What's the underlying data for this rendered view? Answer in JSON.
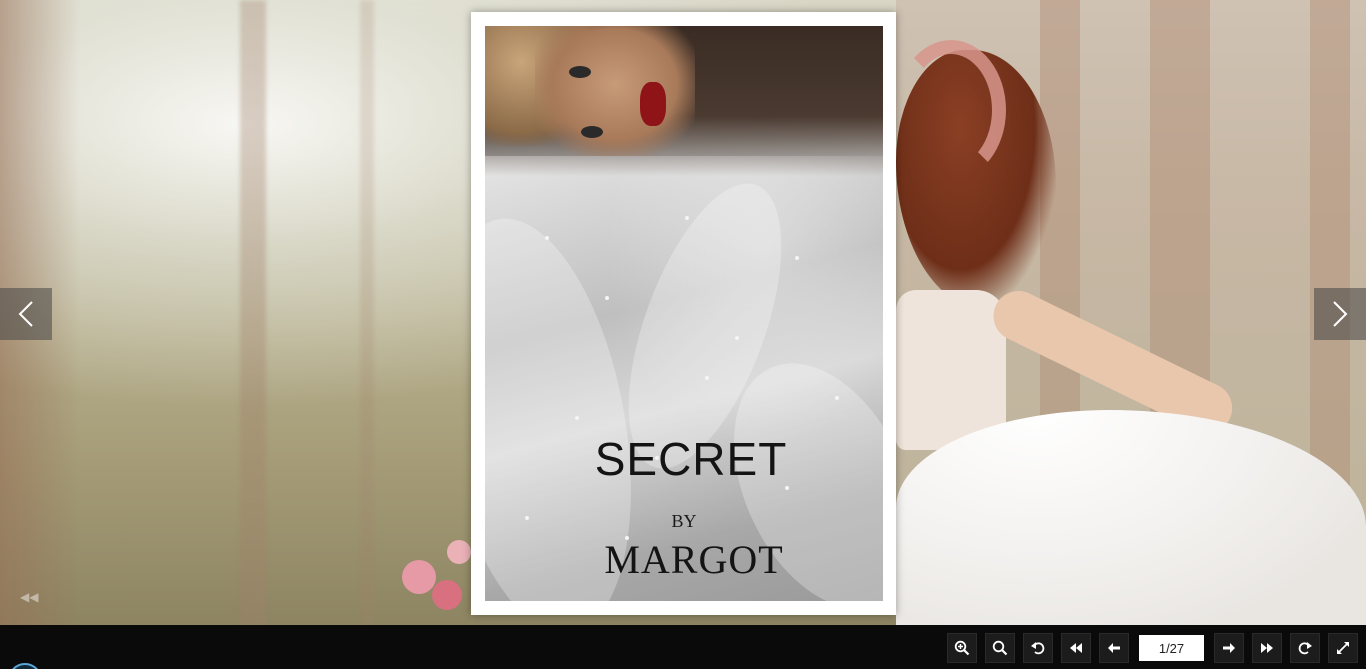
{
  "book": {
    "cover_title": "SECRET",
    "cover_by": "BY",
    "cover_author": "MARGOT"
  },
  "navigation": {
    "prev_icon": "chevron-left-icon",
    "next_icon": "chevron-right-icon"
  },
  "toolbar": {
    "buttons": [
      {
        "name": "zoom-in-button",
        "icon": "zoom-in-icon"
      },
      {
        "name": "zoom-out-button",
        "icon": "zoom-out-icon"
      },
      {
        "name": "rotate-left-button",
        "icon": "undo-icon"
      },
      {
        "name": "first-page-button",
        "icon": "double-left-arrow-icon"
      },
      {
        "name": "previous-page-button",
        "icon": "arrow-left-icon"
      },
      {
        "name": "next-page-button",
        "icon": "arrow-right-icon"
      },
      {
        "name": "last-page-button",
        "icon": "double-right-arrow-icon"
      },
      {
        "name": "rotate-right-button",
        "icon": "redo-icon"
      },
      {
        "name": "fullscreen-button",
        "icon": "expand-icon"
      }
    ],
    "page_indicator": "1/27"
  },
  "colors": {
    "toolbar_bg": "#0a0a0a",
    "lips": "#8e1418",
    "cover_text": "#141414"
  }
}
